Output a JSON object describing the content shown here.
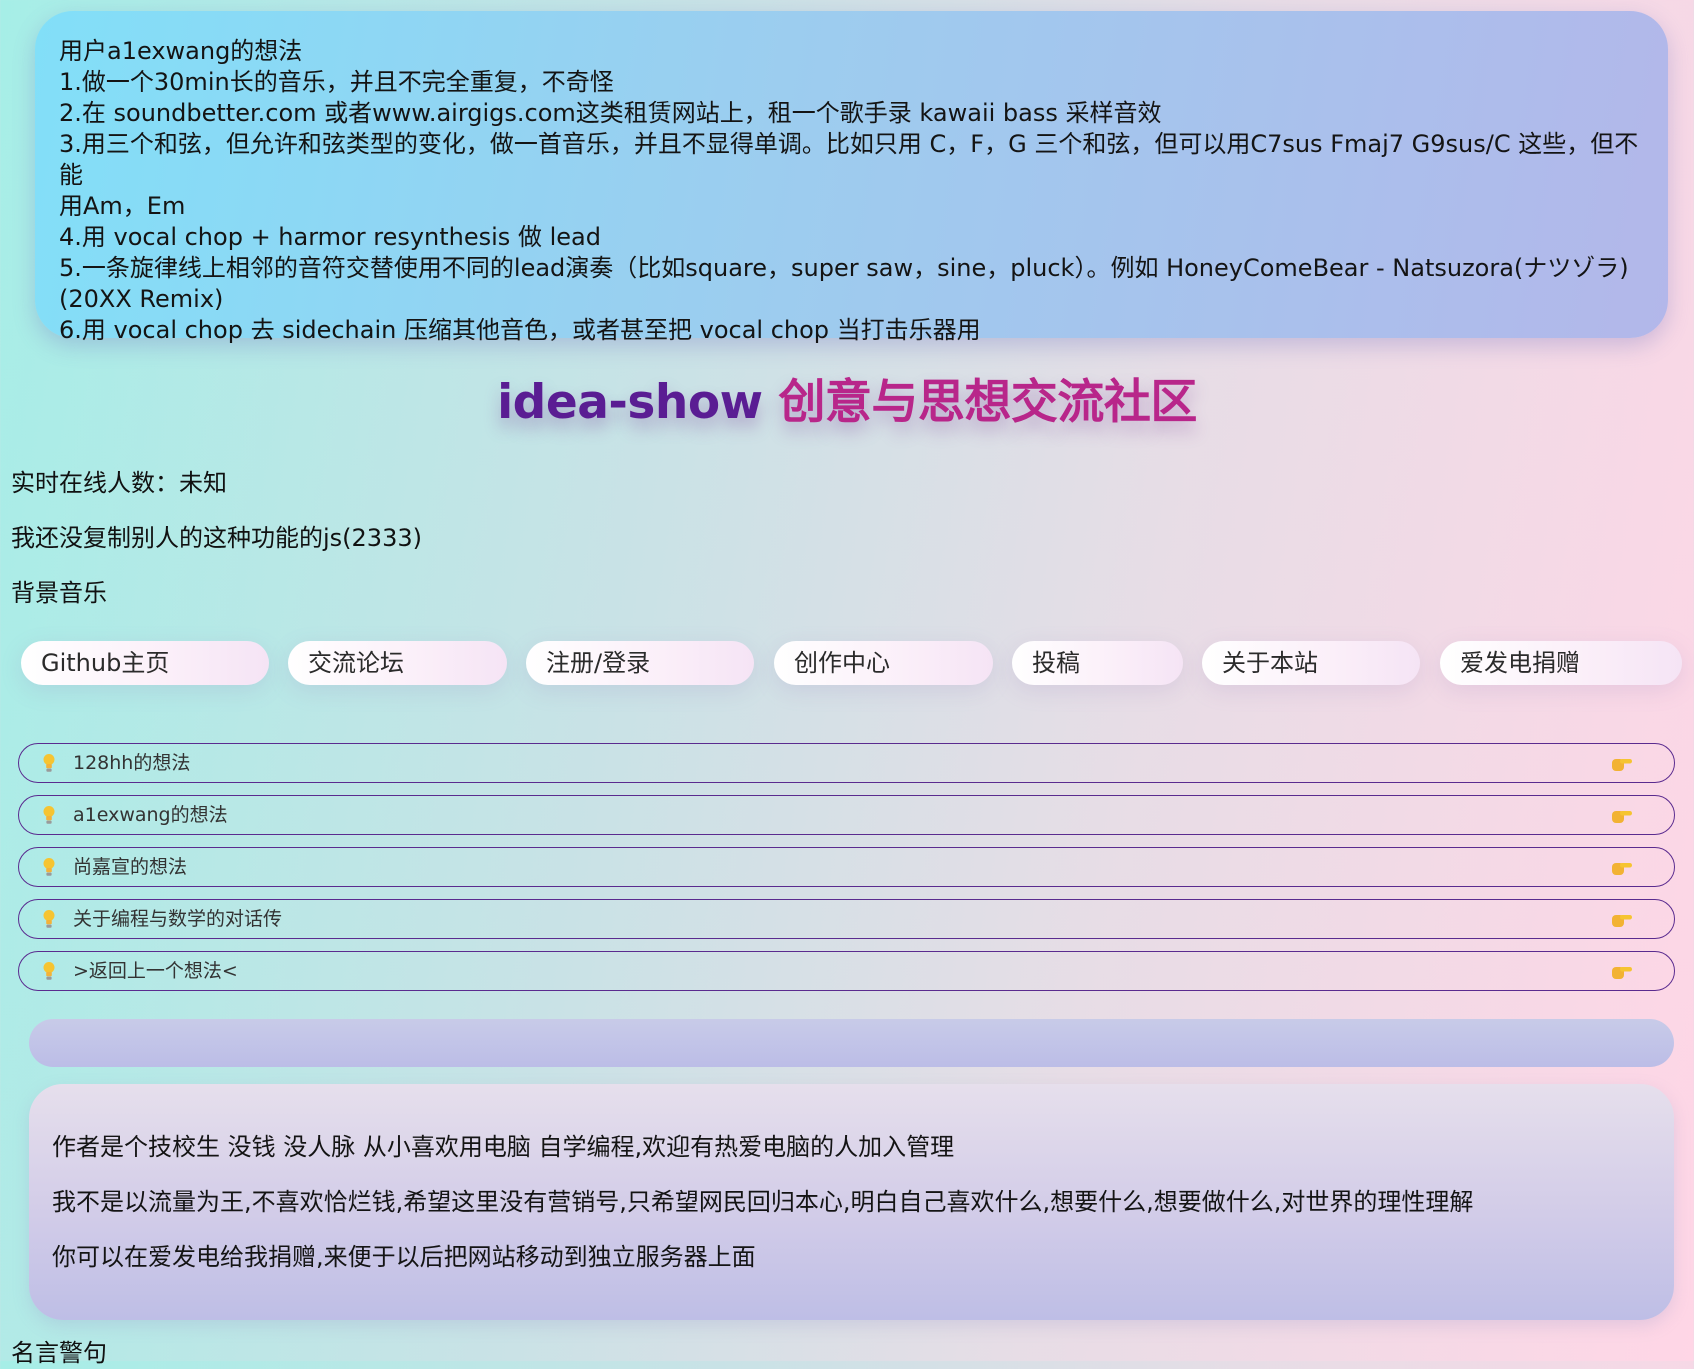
{
  "idea": {
    "lines": [
      "用户a1exwang的想法",
      "1.做一个30min长的音乐，并且不完全重复，不奇怪",
      "2.在 soundbetter.com 或者www.airgigs.com这类租赁网站上，租一个歌手录 kawaii bass 采样音效",
      "3.用三个和弦，但允许和弦类型的变化，做一首音乐，并且不显得单调。比如只用 C，F，G 三个和弦，但可以用C7sus Fmaj7 G9sus/C 这些，但不能",
      "用Am，Em",
      "4.用 vocal chop + harmor resynthesis 做 lead",
      "5.一条旋律线上相邻的音符交替使用不同的lead演奏（比如square，super saw，sine，pluck）。例如 HoneyComeBear - Natsuzora(ナツゾラ)",
      "(20XX Remix)",
      "6.用 vocal chop 去 sidechain 压缩其他音色，或者甚至把 vocal chop 当打击乐器用"
    ]
  },
  "site": {
    "title_en": "idea-show",
    "title_zh": "创意与思想交流社区",
    "online": "实时在线人数：未知",
    "note": "我还没复制别人的这种功能的js(2333)",
    "music": "背景音乐"
  },
  "nav": [
    "Github主页",
    "交流论坛",
    "注册/登录",
    "创作中心",
    "投稿",
    "关于本站",
    "爱发电捐赠"
  ],
  "idea_list": [
    "128hh的想法",
    "a1exwang的想法",
    "尚嘉宣的想法",
    "关于编程与数学的对话传",
    ">返回上一个想法<"
  ],
  "icons": {
    "row_left": "lightbulb-icon",
    "row_right": "pointing-hand-icon"
  },
  "about": {
    "lines": [
      "作者是个技校生 没钱 没人脉 从小喜欢用电脑 自学编程,欢迎有热爱电脑的人加入管理",
      "我不是以流量为王,不喜欢恰烂钱,希望这里没有营销号,只希望网民回归本心,明白自己喜欢什么,想要什么,想要做什么,对世界的理性理解",
      "你可以在爱发电给我捐赠,来便于以后把网站移动到独立服务器上面"
    ]
  },
  "quote_heading": "名言警句",
  "colors": {
    "title_en": "#5a1d93",
    "title_zh": "#b8268a",
    "row_border": "#5a2b8f"
  }
}
